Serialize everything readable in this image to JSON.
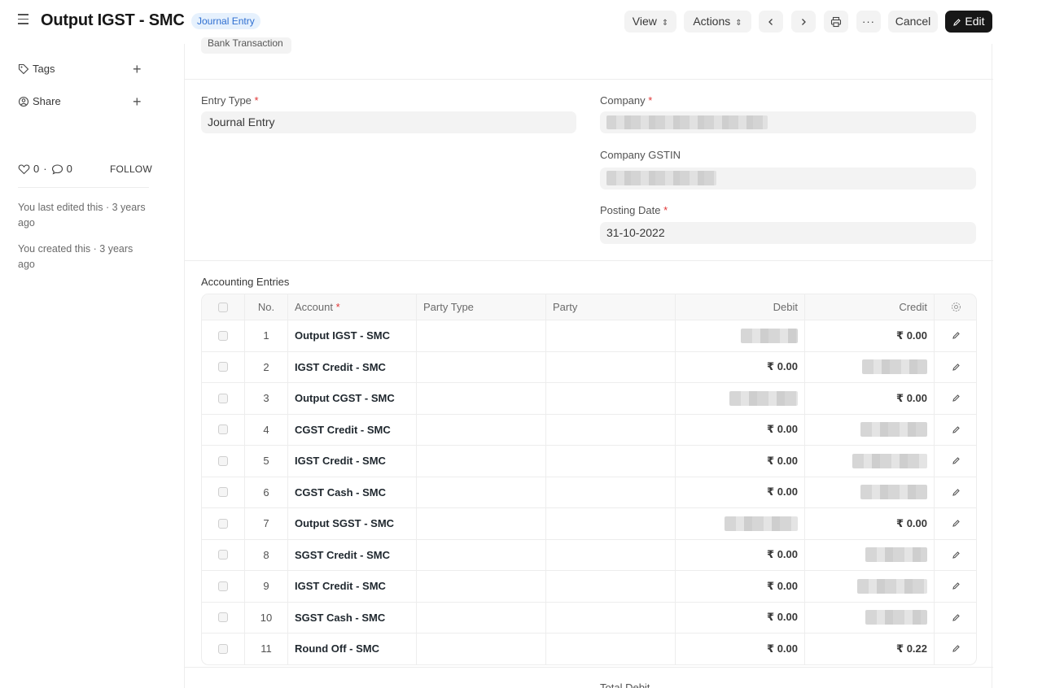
{
  "header": {
    "title": "Output IGST - SMC",
    "doc_type": "Journal Entry",
    "view_label": "View",
    "actions_label": "Actions",
    "cancel_label": "Cancel",
    "edit_label": "Edit"
  },
  "sidebar": {
    "tags_label": "Tags",
    "share_label": "Share",
    "likes_count": "0",
    "comments_count": "0",
    "follow_label": "FOLLOW",
    "last_edited": "You last edited this · 3 years ago",
    "created": "You created this · 3 years ago"
  },
  "form": {
    "bank_chip": "Bank Transaction",
    "entry_type_label": "Entry Type",
    "entry_type_value": "Journal Entry",
    "company_label": "Company",
    "company_gstin_label": "Company GSTIN",
    "posting_date_label": "Posting Date",
    "posting_date_value": "31-10-2022",
    "required_mark": "*"
  },
  "table": {
    "section_label": "Accounting Entries",
    "columns": {
      "no": "No.",
      "account": "Account",
      "party_type": "Party Type",
      "party": "Party",
      "debit": "Debit",
      "credit": "Credit"
    },
    "rows": [
      {
        "no": "1",
        "account": "Output IGST - SMC",
        "debit": null,
        "credit": "₹ 0.00"
      },
      {
        "no": "2",
        "account": "IGST Credit - SMC",
        "debit": "₹ 0.00",
        "credit": null
      },
      {
        "no": "3",
        "account": "Output CGST - SMC",
        "debit": null,
        "credit": "₹ 0.00"
      },
      {
        "no": "4",
        "account": "CGST Credit - SMC",
        "debit": "₹ 0.00",
        "credit": null
      },
      {
        "no": "5",
        "account": "IGST Credit - SMC",
        "debit": "₹ 0.00",
        "credit": null
      },
      {
        "no": "6",
        "account": "CGST Cash - SMC",
        "debit": "₹ 0.00",
        "credit": null
      },
      {
        "no": "7",
        "account": "Output SGST - SMC",
        "debit": null,
        "credit": "₹ 0.00"
      },
      {
        "no": "8",
        "account": "SGST Credit - SMC",
        "debit": "₹ 0.00",
        "credit": null
      },
      {
        "no": "9",
        "account": "IGST Credit - SMC",
        "debit": "₹ 0.00",
        "credit": null
      },
      {
        "no": "10",
        "account": "SGST Cash - SMC",
        "debit": "₹ 0.00",
        "credit": null
      },
      {
        "no": "11",
        "account": "Round Off - SMC",
        "debit": "₹ 0.00",
        "credit": "₹ 0.22"
      }
    ]
  },
  "totals": {
    "total_debit_label": "Total Debit"
  }
}
